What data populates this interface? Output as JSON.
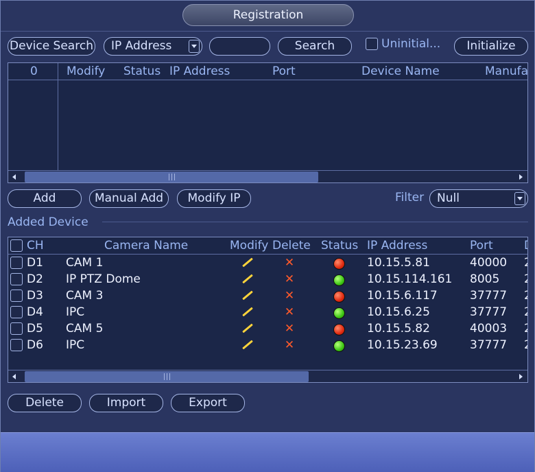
{
  "window": {
    "title": "Registration"
  },
  "toolbar": {
    "device_search_label": "Device Search",
    "search_type": "IP Address",
    "search_input_value": "",
    "search_label": "Search",
    "uninitialized_label": "Uninitial...",
    "initialize_label": "Initialize"
  },
  "search_table": {
    "count": "0",
    "columns": [
      "Modify",
      "Status",
      "IP Address",
      "Port",
      "Device Name",
      "Manufa"
    ]
  },
  "actions": {
    "add_label": "Add",
    "manual_add_label": "Manual Add",
    "modify_ip_label": "Modify IP",
    "filter_label": "Filter",
    "filter_value": "Null"
  },
  "added": {
    "section_title": "Added Device",
    "columns": [
      "CH",
      "Camera Name",
      "Modify",
      "Delete",
      "Status",
      "IP Address",
      "Port",
      "D"
    ],
    "rows": [
      {
        "ch": "D1",
        "name": "CAM 1",
        "status": "offline",
        "ip": "10.15.5.81",
        "port": "40000",
        "more": "2"
      },
      {
        "ch": "D2",
        "name": "IP PTZ Dome",
        "status": "online",
        "ip": "10.15.114.161",
        "port": "8005",
        "more": "2"
      },
      {
        "ch": "D3",
        "name": "CAM 3",
        "status": "offline",
        "ip": "10.15.6.117",
        "port": "37777",
        "more": "2"
      },
      {
        "ch": "D4",
        "name": "IPC",
        "status": "online",
        "ip": "10.15.6.25",
        "port": "37777",
        "more": "2"
      },
      {
        "ch": "D5",
        "name": "CAM 5",
        "status": "offline",
        "ip": "10.15.5.82",
        "port": "40003",
        "more": "2"
      },
      {
        "ch": "D6",
        "name": "IPC",
        "status": "online",
        "ip": "10.15.23.69",
        "port": "37777",
        "more": "2"
      }
    ]
  },
  "footer": {
    "delete_label": "Delete",
    "import_label": "Import",
    "export_label": "Export"
  },
  "icons": {
    "modify": "pencil-icon",
    "delete": "x-icon",
    "status_offline": "red-dot-icon",
    "status_online": "green-dot-icon"
  },
  "colors": {
    "background": "#2a3560",
    "accent_text": "#9ab6f2",
    "online": "#3cc614",
    "offline": "#e02a10",
    "delete_icon": "#ff5a2a",
    "modify_icon": "#ffd43b"
  }
}
